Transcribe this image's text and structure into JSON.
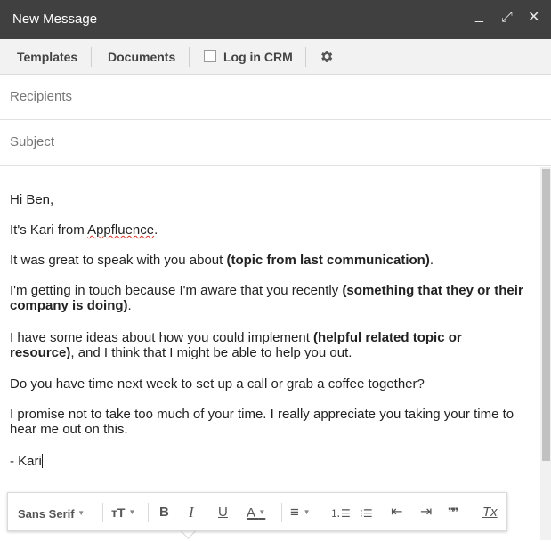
{
  "window": {
    "title": "New Message",
    "minimize_glyph": "_",
    "expand_glyph": "⤢",
    "close_glyph": "✕"
  },
  "toolbar": {
    "templates_label": "Templates",
    "documents_label": "Documents",
    "log_crm_label": "Log in CRM",
    "log_crm_checked": false,
    "settings_icon": "gear-icon"
  },
  "fields": {
    "recipients_placeholder": "Recipients",
    "subject_placeholder": "Subject"
  },
  "body": {
    "greeting": "Hi Ben,",
    "intro_prefix": "It's Kari from ",
    "intro_company": "Appfluence",
    "intro_suffix": ".",
    "p1_text": "It was great to speak with you about ",
    "p1_bold": "(topic from last communication)",
    "p1_end": ".",
    "p2_text": "I'm getting in touch because I'm aware that you recently ",
    "p2_bold": "(something that they or their company is doing)",
    "p2_end": ".",
    "p3_text": "I have some ideas about how you could implement ",
    "p3_bold": "(helpful related topic or resource)",
    "p3_end": ", and I think that I might be able to help you out.",
    "p4": "Do you have time next week to set up a call or grab a coffee together?",
    "p5": "I promise not to take too much of your time. I really appreciate you taking your time to hear me out on this.",
    "signoff": "- Kari"
  },
  "format_bar": {
    "font_label": "Sans Serif",
    "size_glyph": "тT",
    "bold_glyph": "B",
    "italic_glyph": "I",
    "underline_glyph": "U",
    "text_color_glyph": "A",
    "align_glyph": "≡",
    "numbered_list_glyph": "⒈☰",
    "bulleted_list_glyph": "⁝☰",
    "indent_less_glyph": "⇤",
    "indent_more_glyph": "⇥",
    "quote_glyph": "❞❞",
    "clear_format_glyph": "Tx"
  },
  "colors": {
    "titlebar_bg": "#404040",
    "toolbar_bg": "#f2f2f2",
    "spellcheck": "#d93025"
  }
}
